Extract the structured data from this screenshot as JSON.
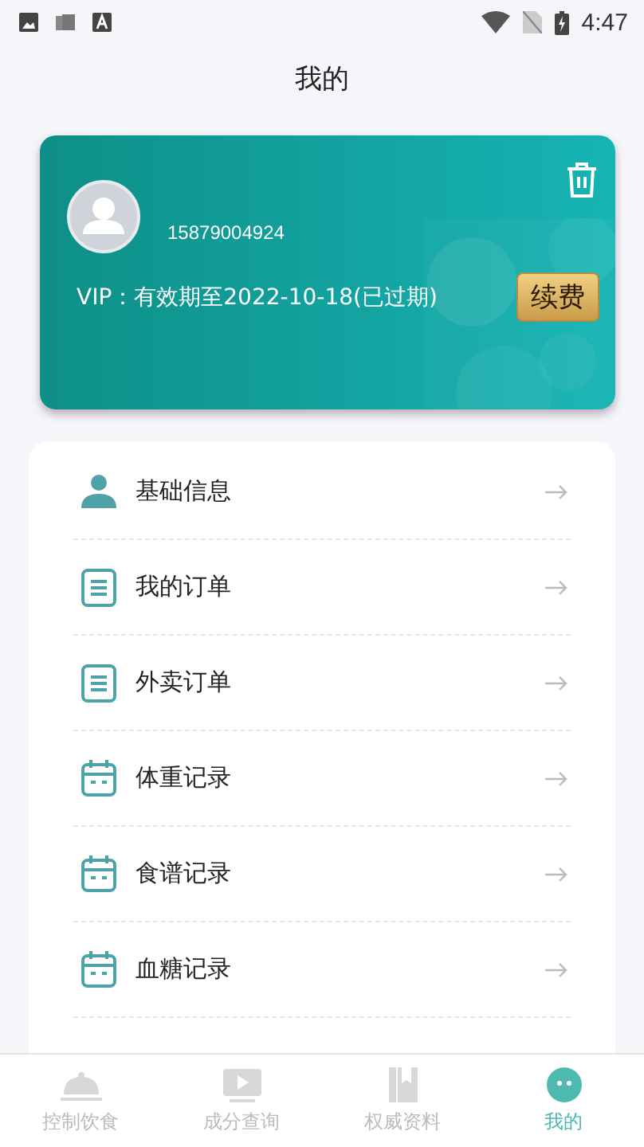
{
  "status_bar": {
    "time": "4:47"
  },
  "title": "我的",
  "vip_card": {
    "phone": "15879004924",
    "vip_text": "VIP：有效期至2022-10-18(已过期)",
    "renew_button": "续费"
  },
  "menu": [
    {
      "kind": "person",
      "label": "基础信息"
    },
    {
      "kind": "list",
      "label": "我的订单"
    },
    {
      "kind": "list",
      "label": "外卖订单"
    },
    {
      "kind": "calendar",
      "label": "体重记录"
    },
    {
      "kind": "calendar",
      "label": "食谱记录"
    },
    {
      "kind": "calendar",
      "label": "血糖记录"
    }
  ],
  "tabs": [
    {
      "label": "控制饮食",
      "selected": false
    },
    {
      "label": "成分查询",
      "selected": false
    },
    {
      "label": "权威资料",
      "selected": false
    },
    {
      "label": "我的",
      "selected": true
    }
  ]
}
